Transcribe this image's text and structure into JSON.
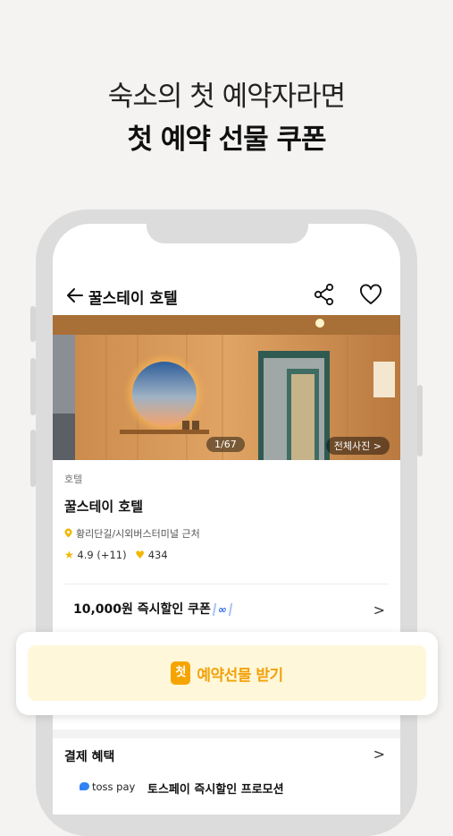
{
  "headline": {
    "line1": "숙소의 첫 예약자라면",
    "line2": "첫 예약 선물 쿠폰"
  },
  "nav": {
    "title": "꿀스테이 호텔"
  },
  "photo": {
    "counter": "1/67",
    "all_label": "전체사진 >"
  },
  "listing": {
    "category": "호텔",
    "name": "꿀스테이 호텔",
    "location": "황리단길/시외버스터미널 근처",
    "rating": "4.9 (+11)",
    "likes": "434"
  },
  "coupon": {
    "label": "10,000원 즉시할인 쿠폰",
    "badge": "∞"
  },
  "gift_card": {
    "badge": "첫",
    "label": "예약선물 받기"
  },
  "payment": {
    "title": "결제 혜택",
    "brand": "toss pay",
    "promo": "토스페이 즉시할인 프로모션"
  },
  "colors": {
    "accent": "#f2a20b",
    "gift_bg": "#fff7d9",
    "star": "#f2b705",
    "toss_blue": "#3182f6"
  }
}
